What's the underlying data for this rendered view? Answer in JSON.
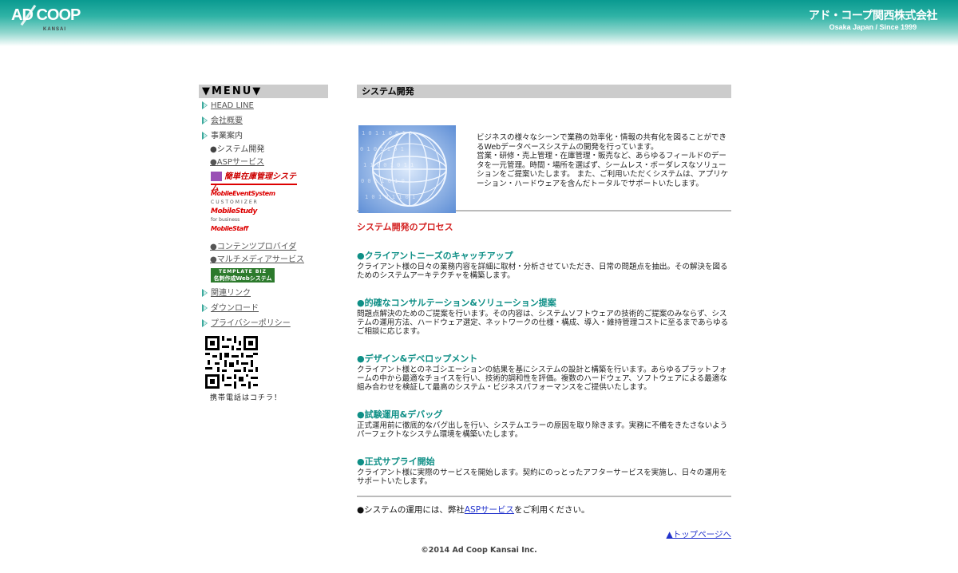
{
  "header": {
    "logo_text": "AD COOP",
    "logo_sub": "KANSAI",
    "company_jp": "アド・コープ関西株式会社",
    "company_en": "Osaka Japan / Since 1999"
  },
  "menu": {
    "heading": "▼MENU▼",
    "items": [
      {
        "label": "HEAD LINE"
      },
      {
        "label": "会社概要"
      },
      {
        "label": "事業案内"
      }
    ],
    "sub_items": [
      {
        "label": "●システム開発"
      },
      {
        "label": "●ASPサービス"
      }
    ],
    "banners": [
      {
        "label": "簡単在庫管理システム"
      },
      {
        "label": "MobileEventSystem",
        "small": "CUSTOMIZER"
      },
      {
        "label": "MobileStudy",
        "small": "for business"
      },
      {
        "label": "MobileStaff"
      }
    ],
    "sub_items2": [
      {
        "label": "●コンテンツプロバイダ"
      },
      {
        "label": "●マルチメディアサービス"
      }
    ],
    "banner_template": {
      "top": "TEMPLATE BIZ",
      "bottom": "名刺作成Webシステム"
    },
    "items2": [
      {
        "label": "関連リンク"
      },
      {
        "label": "ダウンロード"
      },
      {
        "label": "プライバシーポリシー"
      }
    ],
    "qr_caption": "携帯電話はコチラ！"
  },
  "main": {
    "title": "システム開発",
    "intro": "ビジネスの様々なシーンで業務の効率化・情報の共有化を図ることができるWebデータベースシステムの開発を行っています。\n営業・研修・売上管理・在庫管理・販売など、あらゆるフィールドのデータを一元管理。時間・場所を選ばず、シームレス・ボーダレスなソリューションをご提案いたします。 また、ご利用いただくシステムは、アプリケーション・ハードウェアを含んだトータルでサポートいたします。",
    "process_title": "システム開発のプロセス",
    "steps": [
      {
        "heading": "●クライアントニーズのキャッチアップ",
        "text": "クライアント様の日々の業務内容を詳細に取材・分析させていただき、日常の問題点を抽出。その解決を図るためのシステムアーキテクチャを構築します。"
      },
      {
        "heading": "●的確なコンサルテーション&ソリューション提案",
        "text": "問題点解決のためのご提案を行います。その内容は、システムソフトウェアの技術的ご提案のみならず、システムの運用方法、ハードウェア選定、ネットワークの仕様・構成、導入・維持管理コストに至るまであらゆるご相談に応じます。"
      },
      {
        "heading": "●デザイン&デベロップメント",
        "text": "クライアント様とのネゴシエーションの結果を基にシステムの設計と構築を行います。あらゆるプラットフォームの中から最適なチョイスを行い、技術的調和性を評価。複数のハードウェア、ソフトウェアによる最適な組み合わせを検証して最高のシステム・ビジネスパフォーマンスをご提供いたします。"
      },
      {
        "heading": "●試験運用&デバッグ",
        "text": "正式運用前に徹底的なバグ出しを行い、システムエラーの原因を取り除きます。実務に不備をきたさないようパーフェクトなシステム環境を構築いたします。"
      },
      {
        "heading": "●正式サプライ開始",
        "text": "クライアント様に実際のサービスを開始します。契約にのっとったアフターサービスを実施し、日々の運用をサポートいたします。"
      }
    ],
    "note_prefix": "●システムの運用には、弊社",
    "note_link": "ASPサービス",
    "note_suffix": "をご利用ください。",
    "top_link": "▲トップページへ"
  },
  "footer": {
    "copyright": "©2014 Ad Coop Kansai Inc."
  }
}
